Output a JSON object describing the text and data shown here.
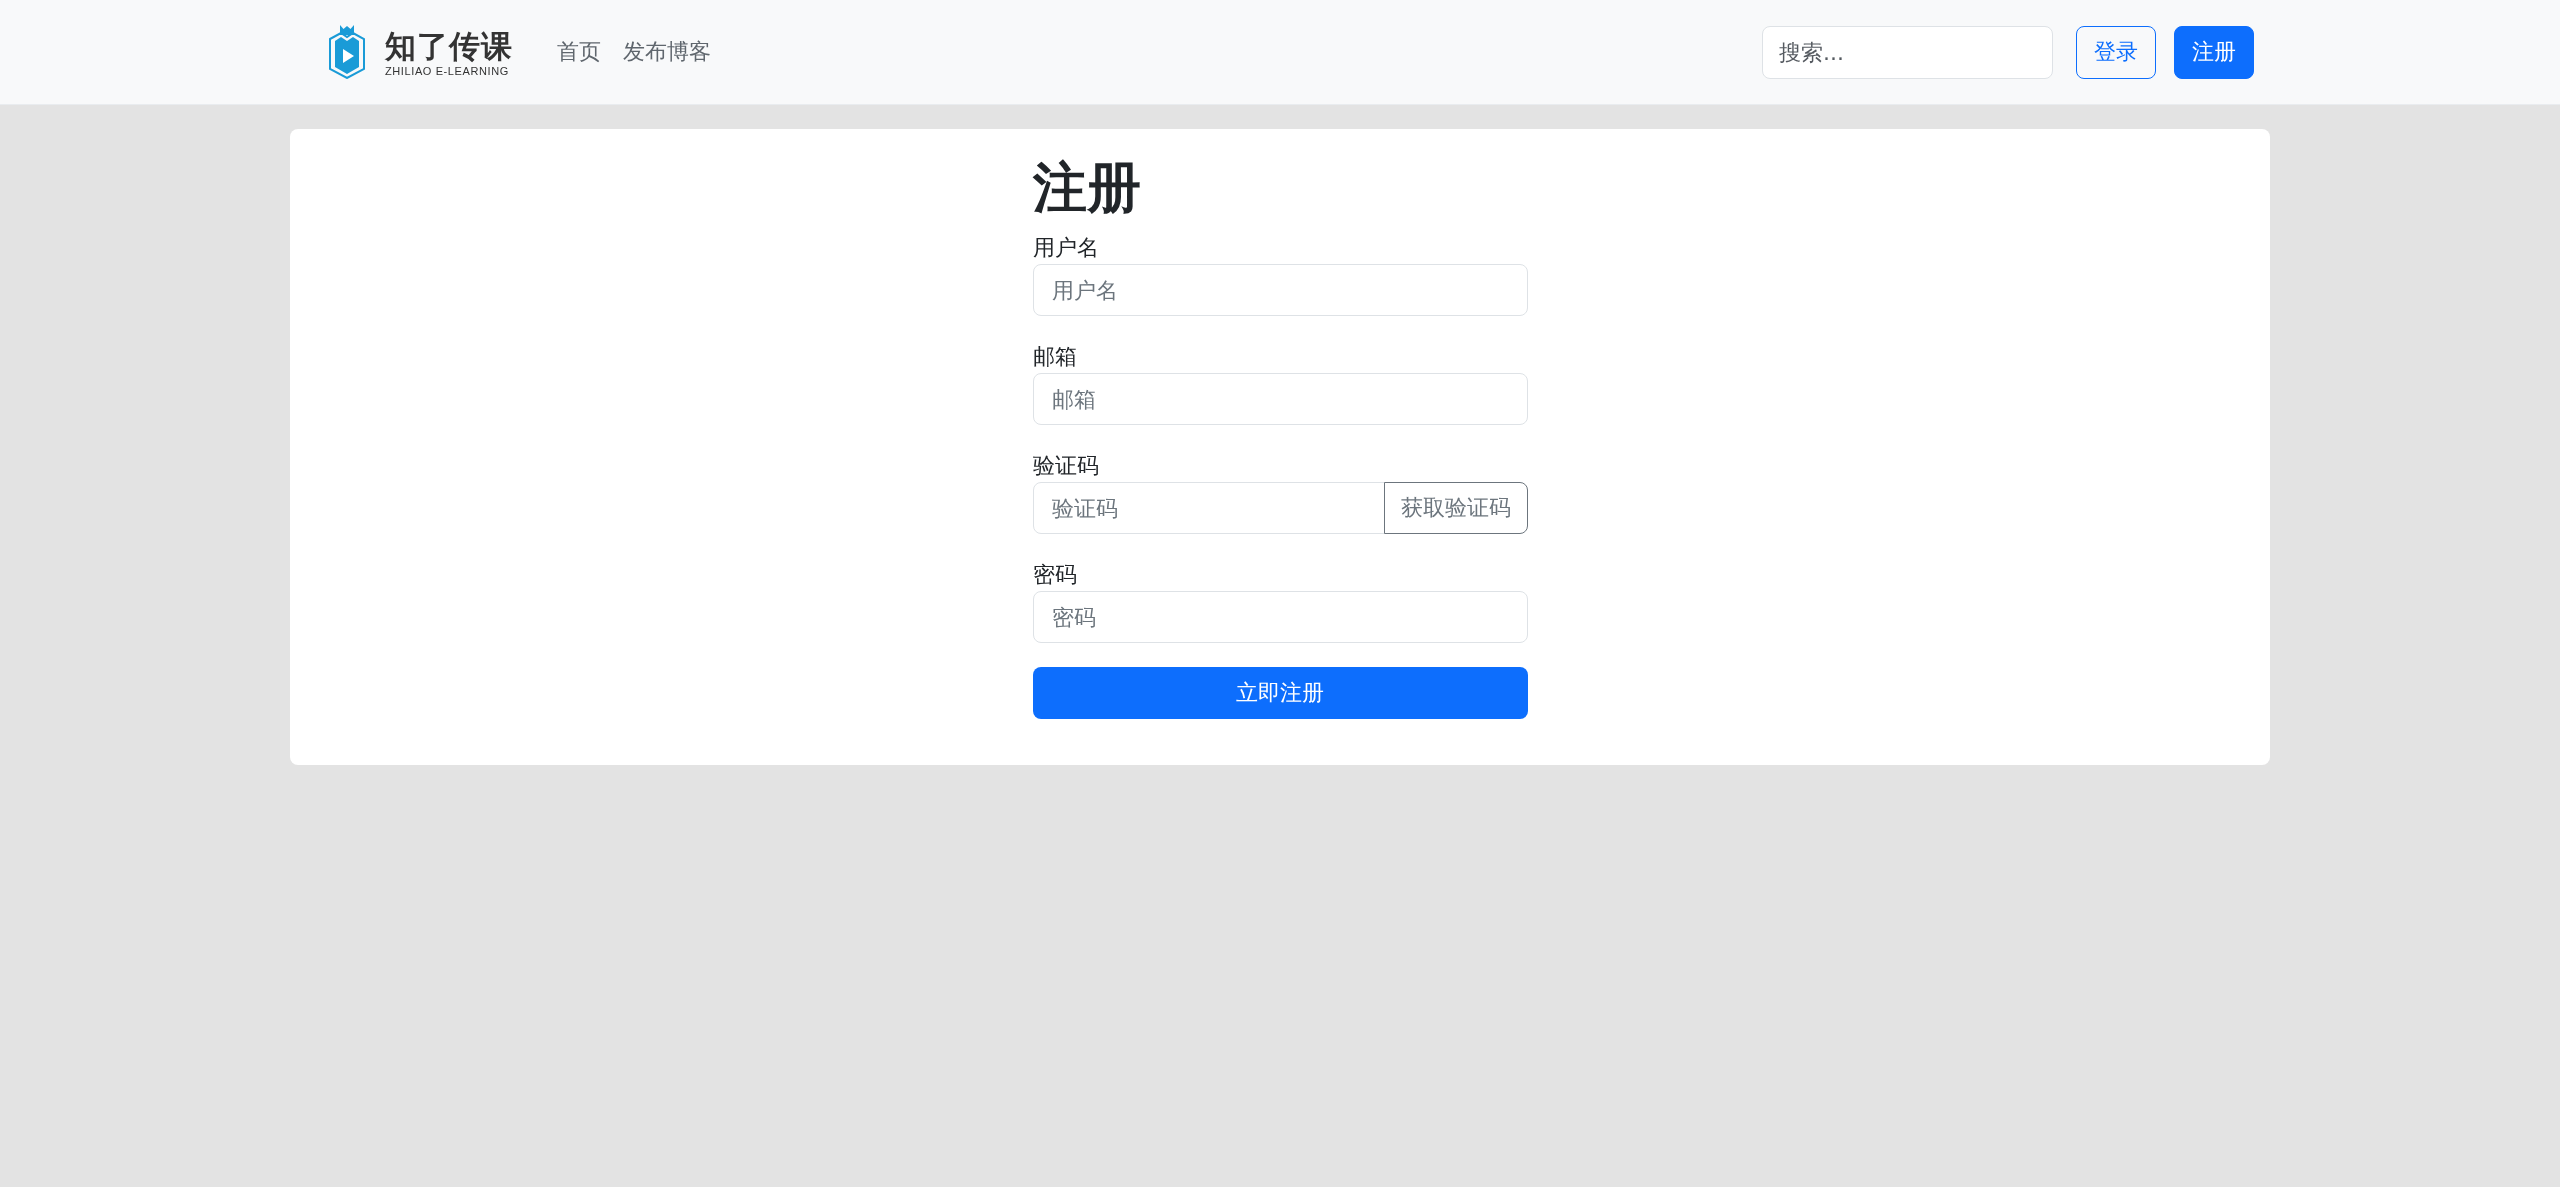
{
  "navbar": {
    "logo": {
      "title": "知了传课",
      "subtitle": "ZHILIAO E-LEARNING"
    },
    "links": [
      {
        "label": "首页"
      },
      {
        "label": "发布博客"
      }
    ],
    "search": {
      "placeholder": "搜索..."
    },
    "buttons": [
      {
        "label": "登录",
        "kind": "outline"
      },
      {
        "label": "注册",
        "kind": "primary"
      }
    ]
  },
  "form": {
    "title": "注册",
    "fields": [
      {
        "label": "用户名",
        "placeholder": "用户名"
      },
      {
        "label": "邮箱",
        "placeholder": "邮箱"
      },
      {
        "label": "验证码",
        "placeholder": "验证码",
        "button": "获取验证码"
      },
      {
        "label": "密码",
        "placeholder": "密码"
      }
    ],
    "submit": "立即注册"
  }
}
